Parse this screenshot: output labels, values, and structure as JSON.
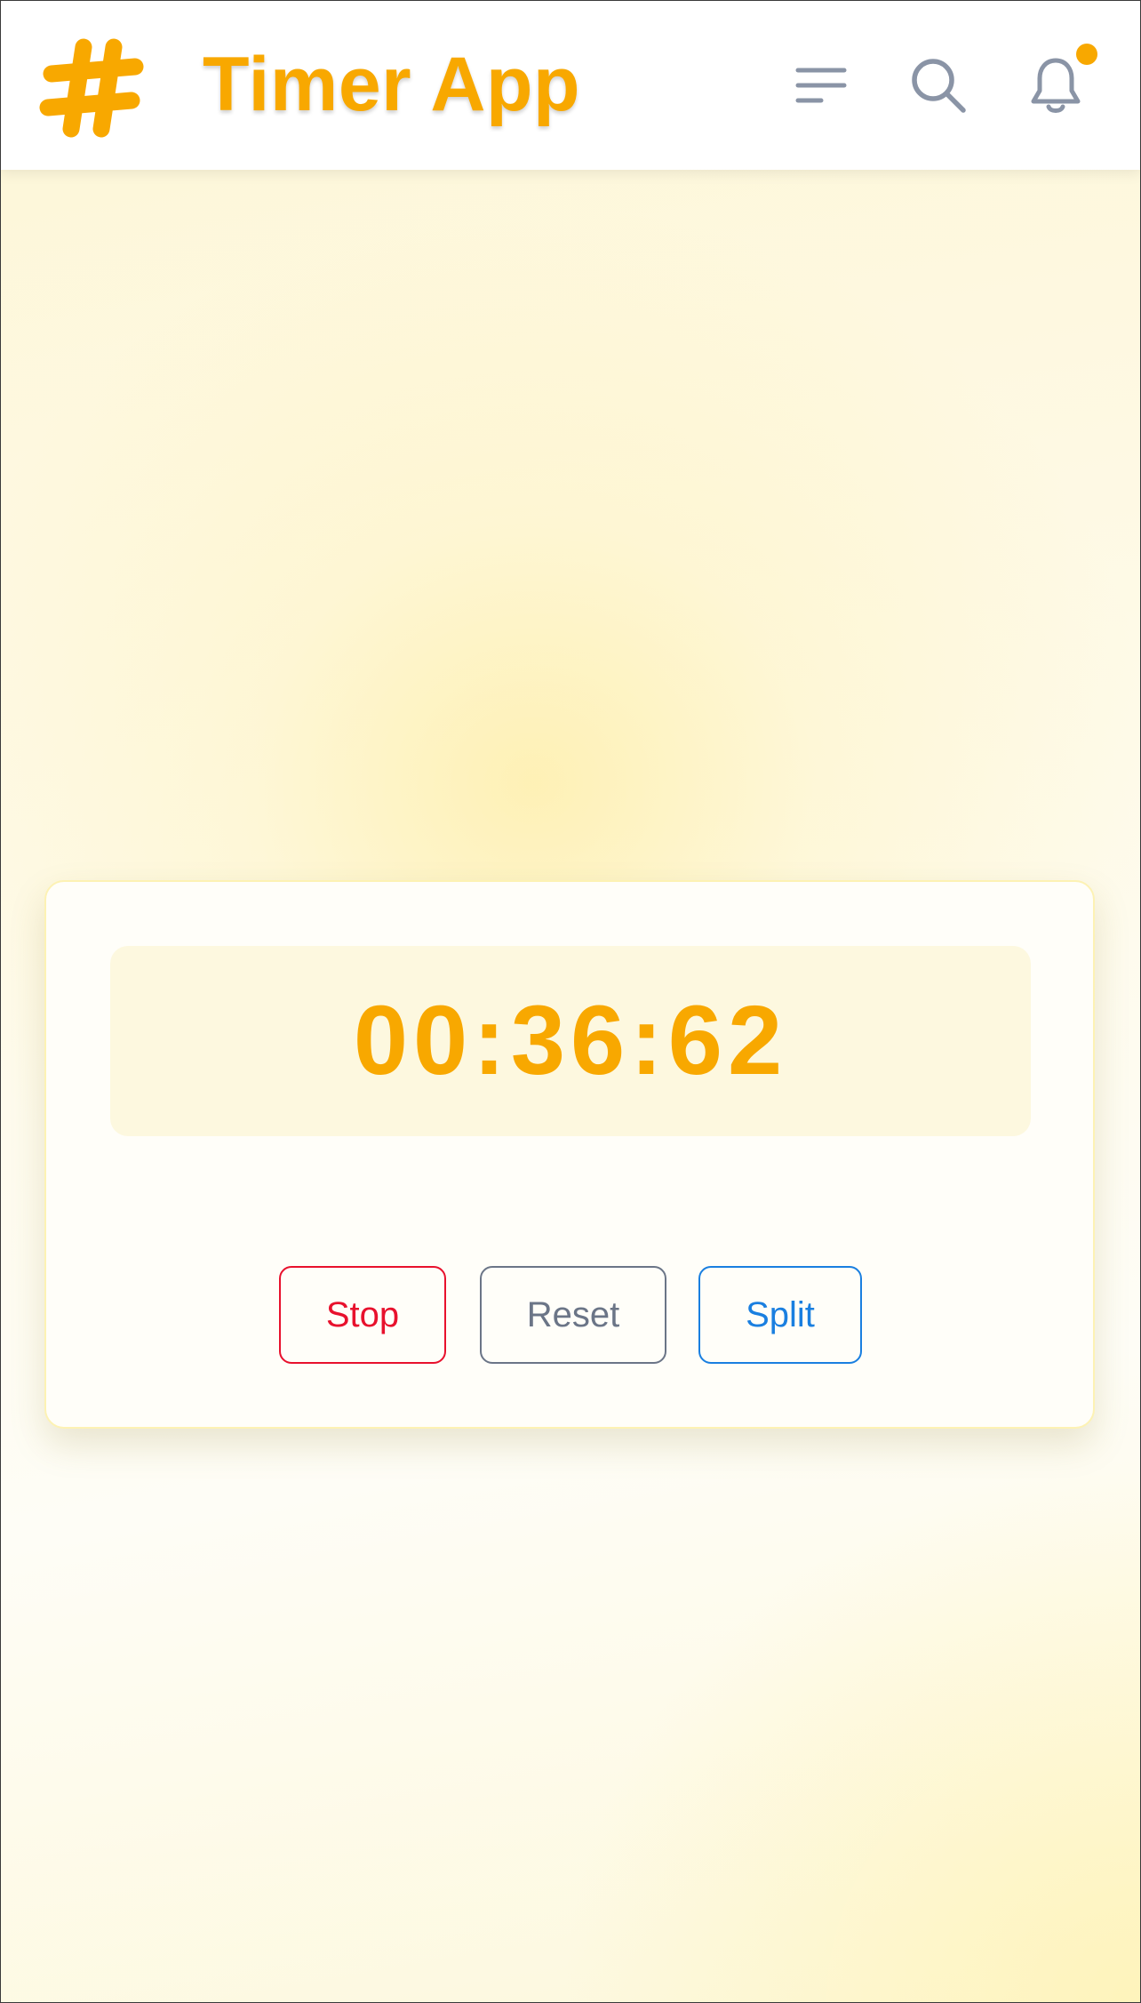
{
  "header": {
    "title": "Timer App",
    "logo_icon": "hashtag-icon",
    "menu_icon": "menu-icon",
    "search_icon": "search-icon",
    "bell_icon": "bell-icon",
    "has_notification": true
  },
  "timer": {
    "display": "00:36:62"
  },
  "controls": {
    "stop_label": "Stop",
    "reset_label": "Reset",
    "split_label": "Split"
  },
  "colors": {
    "accent": "#f8a800",
    "stop": "#e8112d",
    "reset": "#6b7587",
    "split": "#1a7fe0",
    "icon_gray": "#8a94a6"
  }
}
